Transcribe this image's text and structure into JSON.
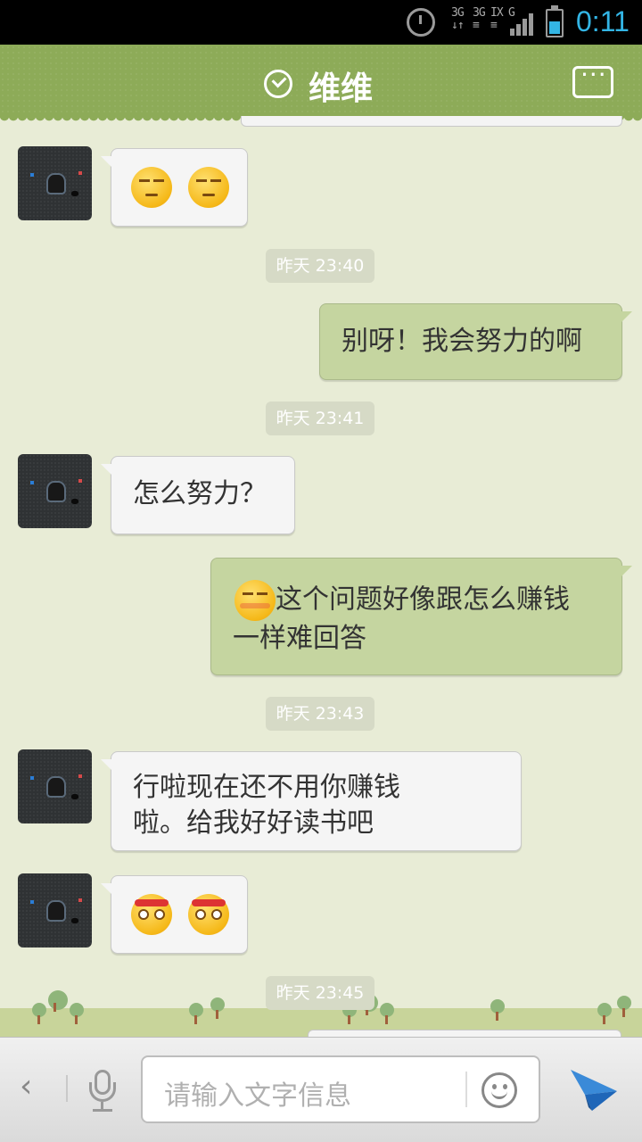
{
  "status_bar": {
    "network_1": "3G",
    "network_2": "3G",
    "network_3": "IX",
    "network_4": "G",
    "time": "0:11",
    "battery_level": 0.55,
    "accent_color": "#33b5e5"
  },
  "header": {
    "title": "维维",
    "status_icon": "check-circle-icon",
    "menu_icon": "chat-menu-icon",
    "bar_color": "#8dab58"
  },
  "messages": [
    {
      "side": "in",
      "type": "emoji",
      "emoji": [
        "smug-face",
        "smug-face"
      ]
    },
    {
      "type": "time",
      "text": "昨天 23:40"
    },
    {
      "side": "out",
      "type": "text",
      "text": "别呀！我会努力的啊"
    },
    {
      "type": "time",
      "text": "昨天 23:41"
    },
    {
      "side": "in",
      "type": "text",
      "text": "怎么努力？"
    },
    {
      "side": "out",
      "type": "text",
      "emoji": "shy-face",
      "line1": "这个问题好像跟怎么赚钱",
      "line2": "一样难回答"
    },
    {
      "type": "time",
      "text": "昨天 23:43"
    },
    {
      "side": "in",
      "type": "text",
      "line1": "行啦现在还不用你赚钱",
      "line2": "啦。给我好好读书吧"
    },
    {
      "side": "in",
      "type": "emoji",
      "emoji": [
        "headband-face",
        "headband-face"
      ]
    },
    {
      "type": "time",
      "text": "昨天 23:45"
    }
  ],
  "input_bar": {
    "placeholder": "请输入文字信息",
    "back_icon": "chevron-left-icon",
    "mic_icon": "microphone-icon",
    "emoji_icon": "smiley-icon",
    "send_icon": "send-icon"
  }
}
